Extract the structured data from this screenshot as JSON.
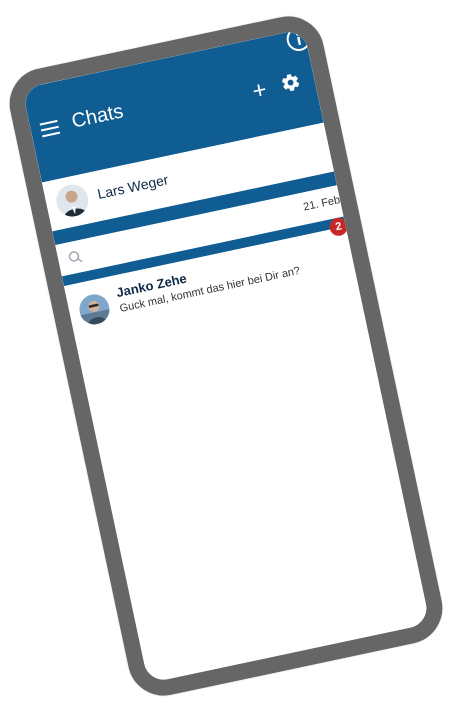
{
  "app": {
    "title": "Chats"
  },
  "header": {
    "add_label": "+"
  },
  "profile": {
    "name": "Lars Weger"
  },
  "search": {
    "placeholder": "",
    "value": ""
  },
  "chats": [
    {
      "name": "Janko Zehe",
      "preview": "Guck mal, kommt das hier bei Dir an?",
      "date": "21. Feb",
      "unread": "2"
    }
  ],
  "icons": {
    "menu": "menu-icon",
    "add": "plus-icon",
    "settings": "gear-icon",
    "info": "info-icon",
    "search": "search-icon"
  },
  "colors": {
    "brand": "#0f5d92",
    "frame": "#666666",
    "badge": "#c62828",
    "background": "#ffffff"
  }
}
